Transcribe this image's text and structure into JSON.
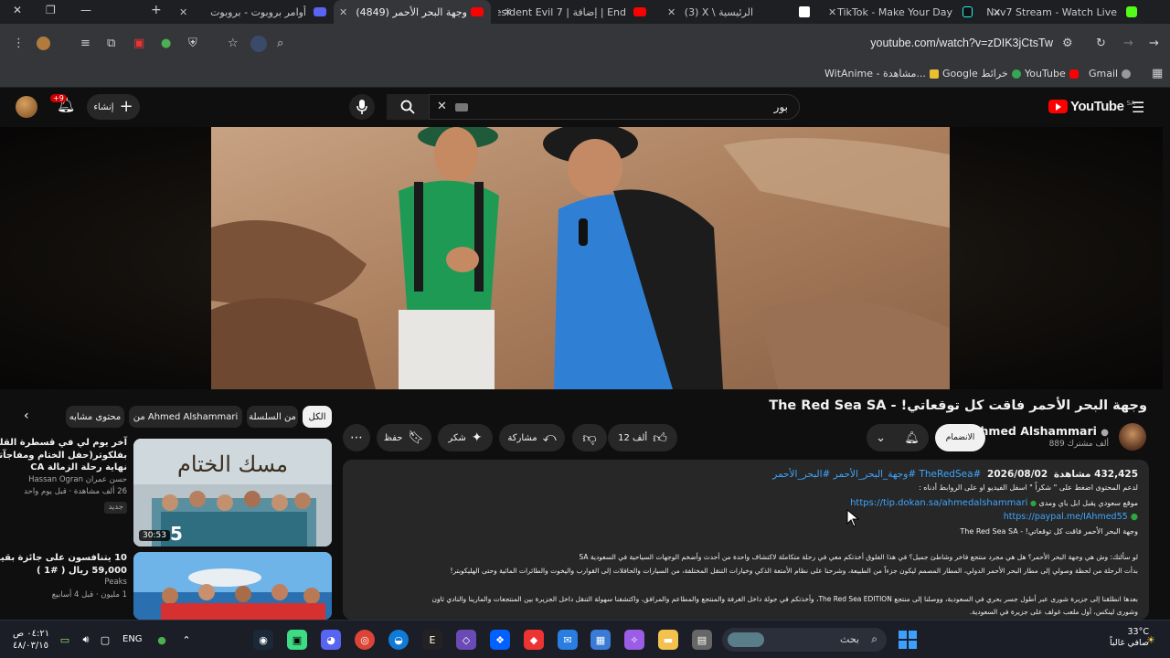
{
  "browser": {
    "tabs": [
      {
        "title": "أوامر بروبوت - بروبوت",
        "active": false
      },
      {
        "title": "(4849) وجهة البحر الأحمر",
        "active": true
      },
      {
        "title": "Resident Evil 7 | إضافة | End",
        "active": false
      },
      {
        "title": "(3) X \\ الرئيسية",
        "active": false
      },
      {
        "title": "TikTok - Make Your Day",
        "active": false
      },
      {
        "title": "Nxv7 Stream - Watch Live",
        "active": false
      }
    ],
    "url": "youtube.com/watch?v=zDIK3jCtsTw",
    "extension_badge": "6",
    "bookmarks": [
      {
        "label": "Gmail"
      },
      {
        "label": "YouTube"
      },
      {
        "label": "Google خرائط"
      },
      {
        "label": "WitAnime - مشاهدة..."
      }
    ]
  },
  "masthead": {
    "logo_text": "YouTube",
    "region": "SA",
    "search_value": "بور",
    "create_label": "إنشاء",
    "notif_count": "+9"
  },
  "video": {
    "title": "وجهة البحر الأحمر فاقت كل توقعاتي! - The Red Sea SA",
    "channel_name": "Ahmed Alshammari",
    "subscribers": "889 ألف مشترك",
    "subscribe_label": "الانضمام",
    "likes": "12 ألف",
    "share_label": "مشاركة",
    "thanks_label": "شكر",
    "save_label": "حفظ",
    "description": {
      "views": "432,425 مشاهدة",
      "date": "2026/08/02",
      "tags": "#TheRedSea #وجهة_البحر_الأحمر #البحر_الأحمر",
      "line1": "لدعم المحتوى اضغط على \" شكراً \" اسفل الفيديو او على الروابط أدناه :",
      "line2_label": "موقع سعودي يقبل ابل باي ومدى",
      "line2_link": "https://tip.dokan.sa/ahmedalshammari",
      "line3_link": "https://paypal.me/IAhmed55",
      "line4": "وجهة البحر الأحمر فاقت كل توقعاتي! - The Red Sea SA",
      "para1": "لو سألتك: وش هي وجهة البحر الأحمر؟ هل هي مجرد منتجع فاخر وشاطئ جميل؟ في هذا الفلوق أخذتكم معي في رحلة متكاملة لاكتشاف واحدة من أحدث وأضخم الوجهات السياحية في السعودية SA",
      "para2": "بدأت الرحلة من لحظة وصولي إلى مطار البحر الأحمر الدولي، المطار المصمم ليكون جزءاً من الطبيعة، وشرحنا على نظام الأمتعة الذكي وخيارات التنقل المختلفة، من السيارات والحافلات إلى القوارب واليخوت والطائرات المائية وحتى الهليكوبتر!",
      "para3": "بعدها انطلقنا إلى جزيرة شورى عبر أطول جسر بحري في السعودية، ووصلنا إلى منتجع The Red Sea EDITION، وأخذتكم في جولة داخل الغرفة والمنتجع والمطاعم والمرافق، واكتشفنا سهولة التنقل داخل الجزيرة بين المنتجعات والمارينا والنادي ثاون",
      "para4": "وشورى لينكس، أول ملعب غولف على جزيرة في السعودية."
    }
  },
  "sidebar": {
    "chips": [
      {
        "label": "الكل",
        "selected": true
      },
      {
        "label": "من السلسلة",
        "selected": false
      },
      {
        "label": "من Ahmed Alshammari",
        "selected": false
      },
      {
        "label": "محتوى مشابه",
        "selected": false
      }
    ],
    "recs": [
      {
        "title1": "آخر يوم لي في قسطرة القلب",
        "title2": "بفلكوتر(حفل الختام ومفاجآتي لهم)..",
        "title3": "نهاية رحلة الزمالة CA",
        "channel": "حسن عمران Hassan Ogran",
        "meta": "26 ألف مشاهدة · قبل يوم واحد",
        "badge": "جديد",
        "duration": "30:53",
        "thumb_text": "مسك الختام",
        "thumb_number": "5"
      },
      {
        "title1": "10 يتنافسون على جائزة بقيمة",
        "title2": "59,000 ريال ( #1 )",
        "channel": "Peaks",
        "meta": "1 مليون · قبل 4 أسابيع"
      }
    ]
  },
  "taskbar": {
    "search_placeholder": "بحث",
    "lang": "ENG",
    "time": "٠٤:٢١ ص",
    "date": "٤٨/٠٣/١٥",
    "weather_temp": "33°C",
    "weather_desc": "صافي غالباً"
  },
  "colors": {
    "bg": "#0f0f0f",
    "brand_red": "#ff0000",
    "link_blue": "#3ea6ff"
  }
}
